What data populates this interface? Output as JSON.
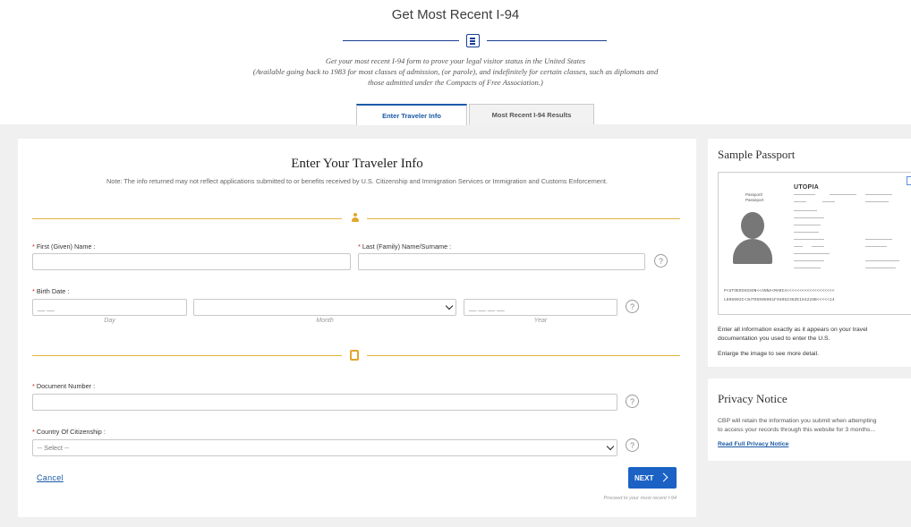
{
  "header": {
    "title": "Get Most Recent I-94",
    "description_lines": [
      "Get your most recent I-94 form to prove your legal visitor status in the United States",
      "(Available going back to 1983 for most classes of admission, (or parole), and indefinitely for certain classes, such as diplomats and",
      "those admitted under the Compacts of Free Association.)"
    ]
  },
  "tabs": [
    {
      "label": "Enter Traveler Info",
      "active": true
    },
    {
      "label": "Most Recent I-94 Results",
      "active": false
    }
  ],
  "form": {
    "title": "Enter Your Traveler Info",
    "note": "Note: The info returned may not reflect applications submitted to or benefits received by U.S. Citizenship and Immigration Services or Immigration and Customs Enforcement.",
    "required_marker": "*",
    "first_name_label": "First (Given) Name :",
    "last_name_label": "Last (Family) Name/Surname :",
    "birth_date_label": "Birth Date :",
    "day_placeholder": "__ __",
    "day_sublabel": "Day",
    "month_sublabel": "Month",
    "year_placeholder": "__ __ __ __",
    "year_sublabel": "Year",
    "document_number_label": "Document Number :",
    "country_label": "Country Of Citizenship :",
    "country_selected": "-- Select --",
    "help_glyph": "?",
    "cancel_label": "Cancel",
    "next_label": "NEXT",
    "proceed_text": "Proceed to your most recent I-94"
  },
  "sample_passport": {
    "title": "Sample Passport",
    "country": "UTOPIA",
    "passport_label_1": "Passport/",
    "passport_label_2": "Passeport",
    "mrz_line_1": "P<UTOERIKSSON<<ANNA<MARIA<<<<<<<<<<<<<<<<<<<",
    "mrz_line_2": "L898902C<3UTO6908061F9406236ZE184226B<<<<<14",
    "instructions_1": "Enter all information exactly as it appears on your travel",
    "instructions_2": "documentation you used to enter the U.S.",
    "enlarge_text": "Enlarge the image to see more detail."
  },
  "privacy": {
    "title": "Privacy Notice",
    "text_1": "CBP will retain the information you submit when attempting",
    "text_2": "to access your records through this website for 3 months...",
    "link_label": "Read Full Privacy Notice"
  },
  "colors": {
    "accent_blue": "#1b62c4",
    "navy_rule": "#1c3f94",
    "gold_rule": "#e2b33c",
    "required_red": "#cc2222"
  }
}
